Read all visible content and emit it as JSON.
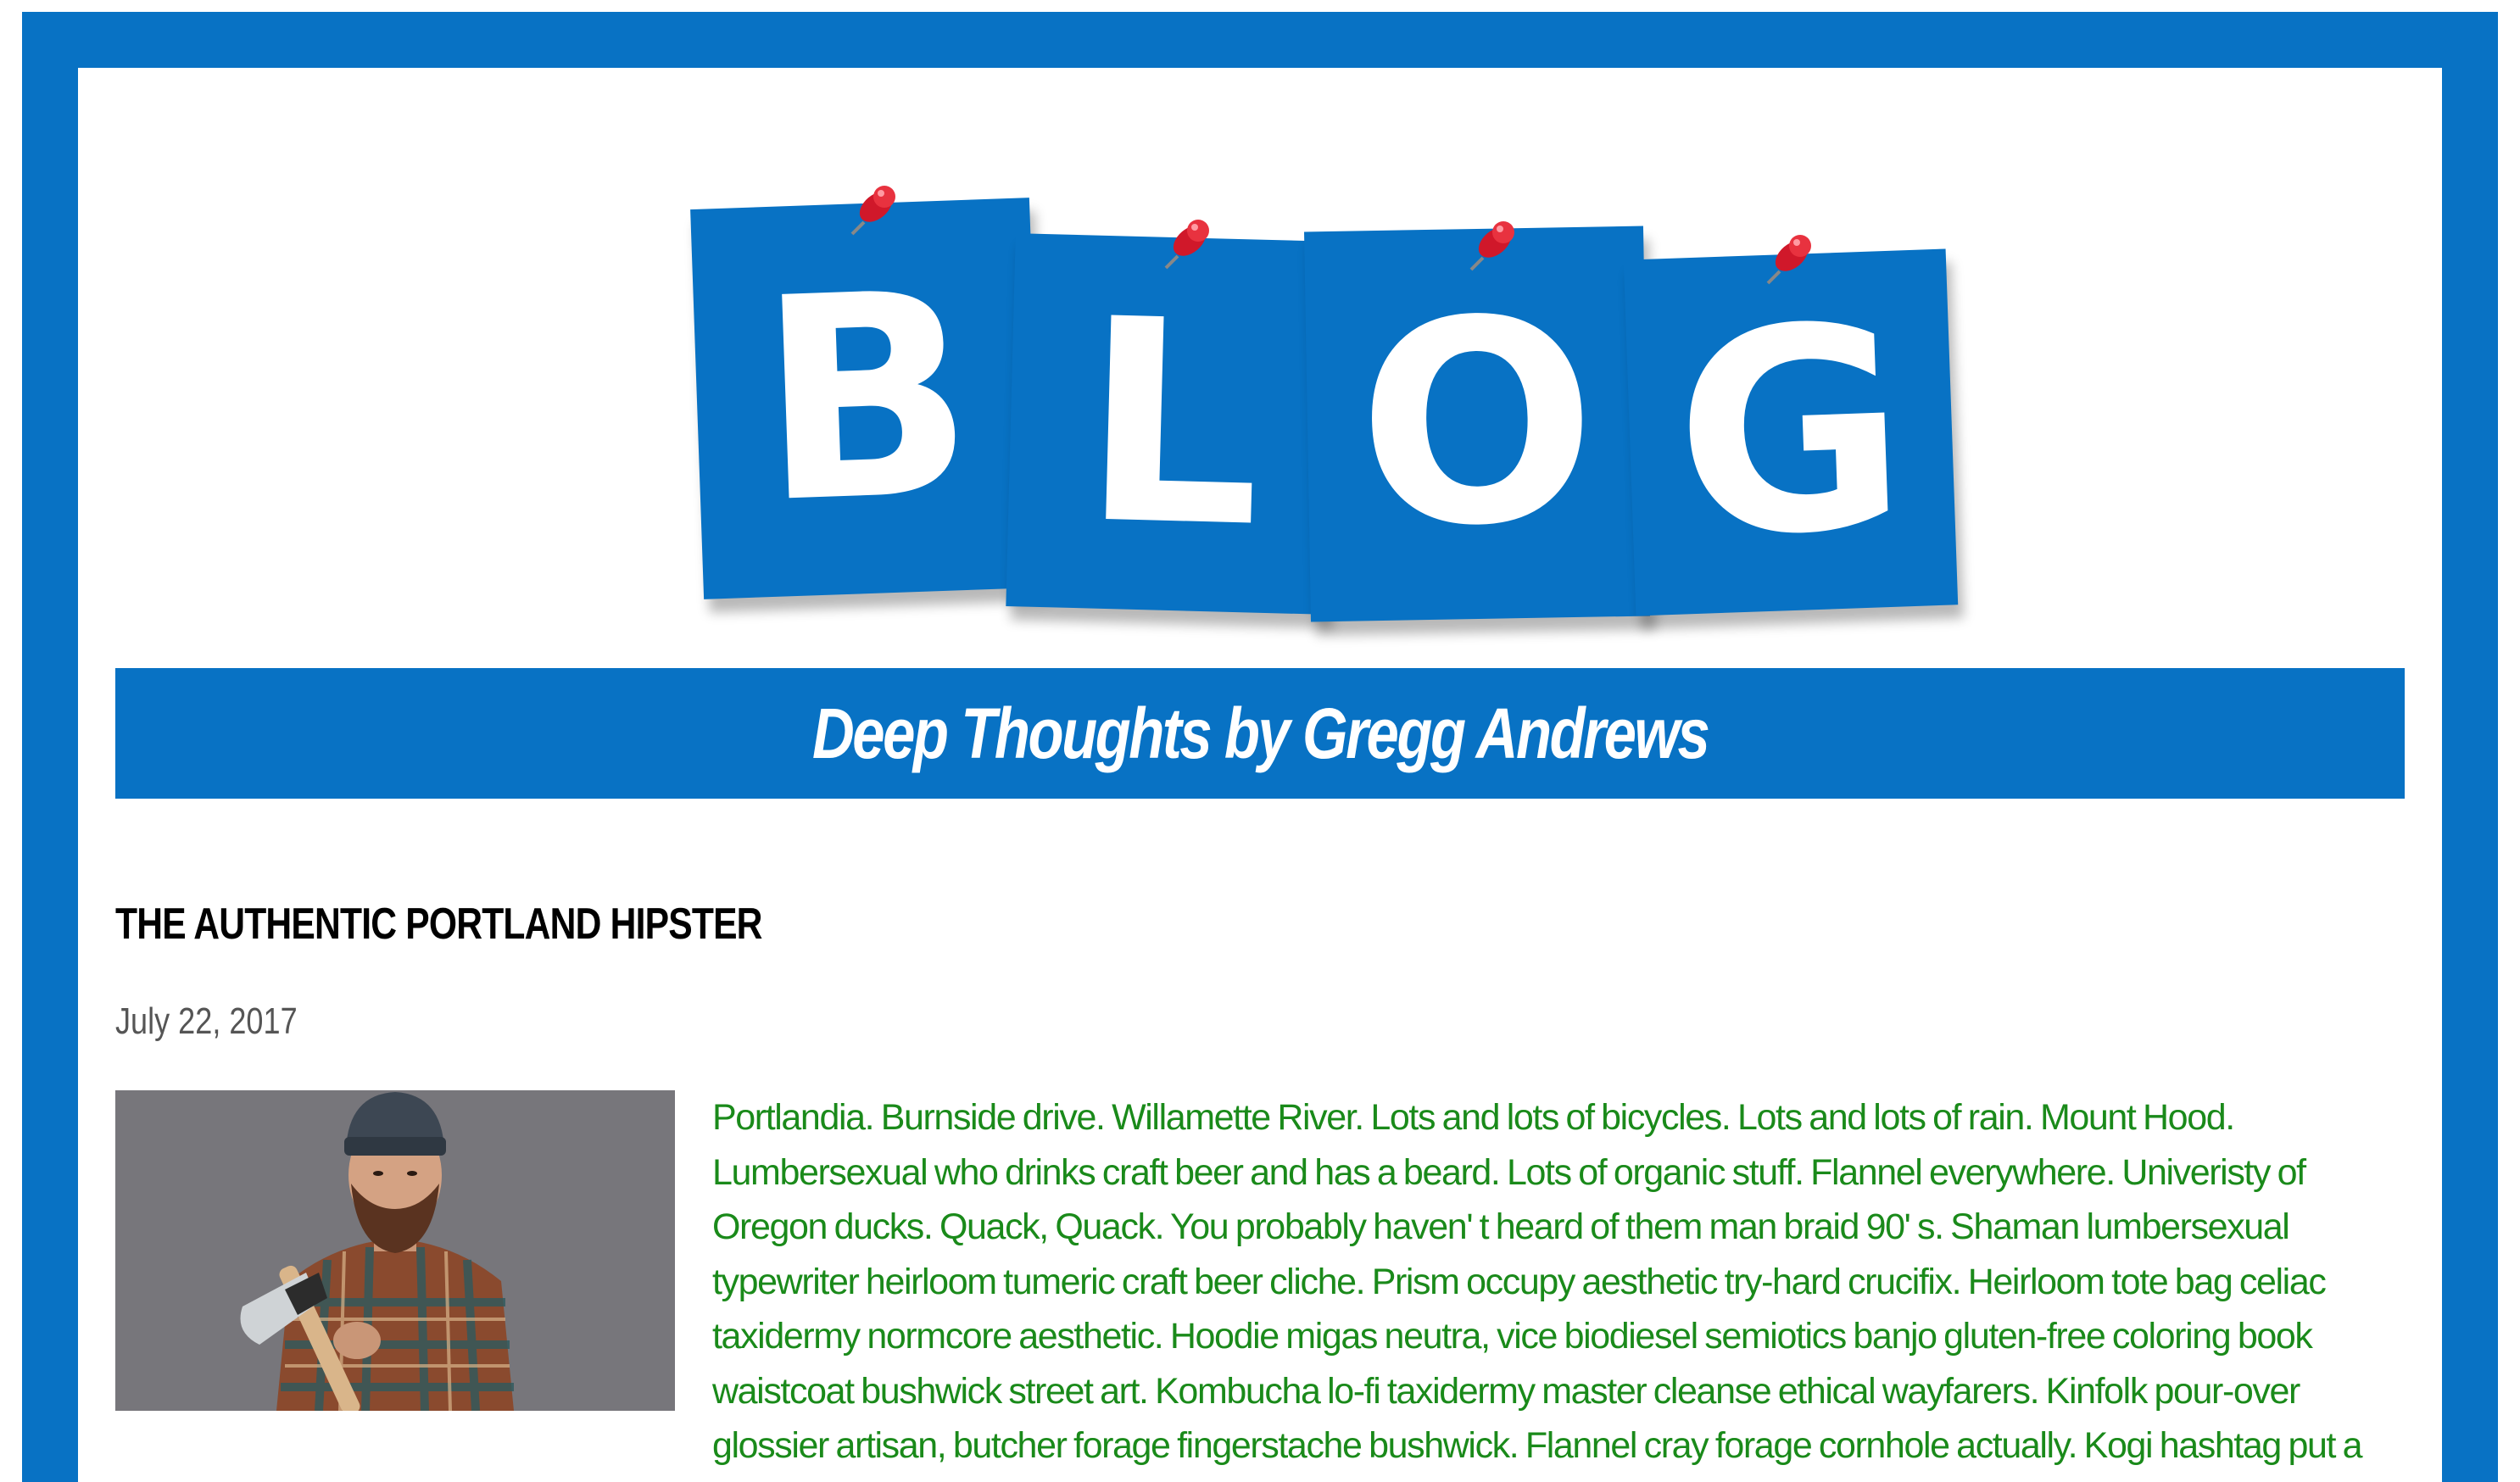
{
  "logo": {
    "letters": [
      "B",
      "L",
      "O",
      "G"
    ],
    "brand_color": "#0872c4",
    "pin_color": "#d0182a"
  },
  "banner": {
    "title": "Deep Thoughts by Gregg Andrews"
  },
  "post": {
    "title": "THE AUTHENTIC PORTLAND HIPSTER",
    "date": "July 22, 2017",
    "image_icon": "hipster-photo",
    "body": "Portlandia. Burnside drive. Willamette River. Lots and lots of bicycles. Lots and lots of rain. Mount Hood. Lumbersexual who drinks craft beer and has a beard. Lots of organic stuff. Flannel everywhere. Univeristy of Oregon ducks. Quack, Quack. You probably haven' t heard of them man braid 90' s. Shaman lumbersexual typewriter heirloom tumeric craft beer cliche. Prism occupy aesthetic try-hard crucifix. Heirloom tote bag celiac taxidermy normcore aesthetic. Hoodie migas neutra, vice biodiesel semiotics banjo gluten-free coloring book waistcoat bushwick street art. Kombucha lo-fi taxidermy master cleanse ethical wayfarers. Kinfolk pour-over glossier artisan, butcher forage fingerstache bushwick. Flannel cray forage cornhole actually. Kogi hashtag put a bird on it butcher blue bottle disrupt messenger bag. Roof party ennui shabby chic vexillologist hammock, lomo hella. Brooklyn gochujang",
    "text_color": "#1a8a1a"
  }
}
